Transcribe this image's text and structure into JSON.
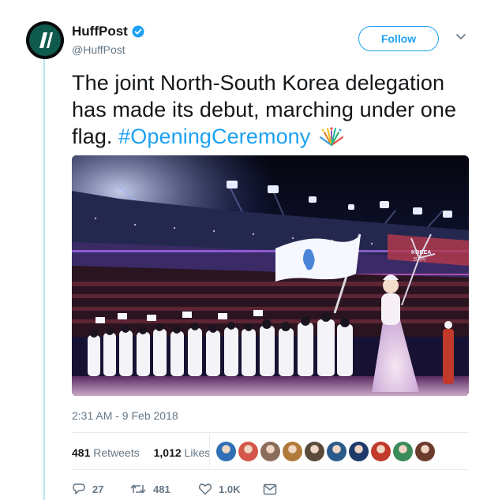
{
  "account": {
    "display_name": "HuffPost",
    "handle": "@HuffPost",
    "avatar_color": "#0e5a4c",
    "verified": true
  },
  "follow_button": {
    "label": "Follow"
  },
  "tweet": {
    "text_part1": "The joint North-South Korea delegation has made its debut, marching under one flag.",
    "hashtag": "#OpeningCeremony",
    "flag_text": "KOREA\n코리아",
    "timestamp": "2:31 AM - 9 Feb 2018"
  },
  "stats": {
    "retweets_count": "481",
    "retweets_label": "Retweets",
    "likes_count": "1,012",
    "likes_label": "Likes",
    "liker_avatars": [
      "#2f6fb5",
      "#d4564b",
      "#8a6e5a",
      "#b07a3a",
      "#5a4a3a",
      "#2a5a8a",
      "#1d3a6a",
      "#c0392b",
      "#3a8a5a",
      "#6a3a2a"
    ]
  },
  "actions": {
    "reply_count": "27",
    "retweet_count": "481",
    "like_count": "1.0K"
  },
  "colors": {
    "accent": "#1da1f2",
    "text": "#14171a",
    "secondary": "#657786",
    "thread": "#b6e7ec"
  },
  "icons": [
    "huffpost-logo-icon",
    "verified-badge-icon",
    "chevron-down-icon",
    "sparkle-icon",
    "reply-icon",
    "retweet-icon",
    "like-icon",
    "direct-message-icon"
  ]
}
